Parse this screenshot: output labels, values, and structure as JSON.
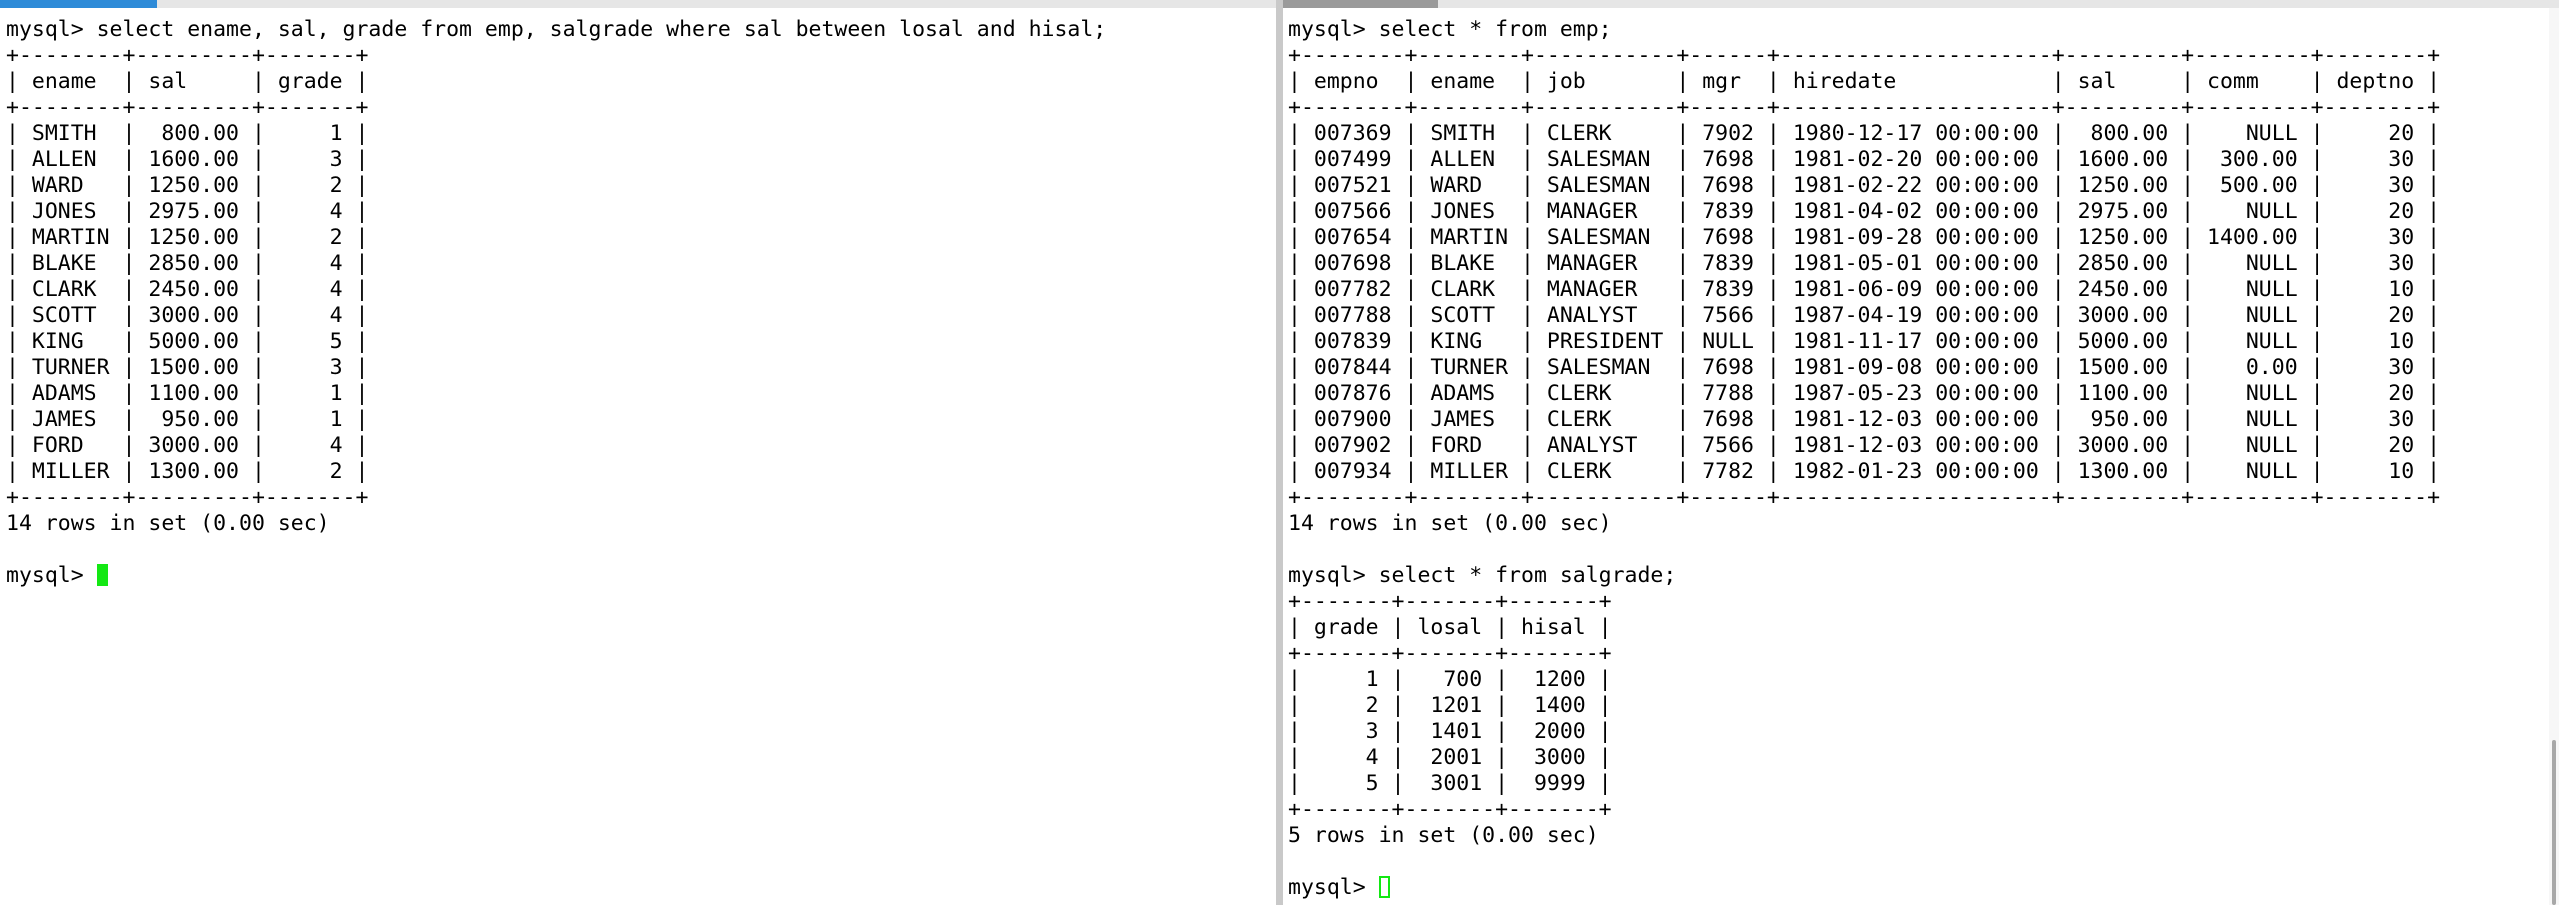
{
  "accent_color": "#2e8bd8",
  "cursor_color": "#13e813",
  "left_pane": {
    "lines": [
      "mysql> select ename, sal, grade from emp, salgrade where sal between losal and hisal;",
      "+--------+---------+-------+",
      "| ename  | sal     | grade |",
      "+--------+---------+-------+",
      "| SMITH  |  800.00 |     1 |",
      "| ALLEN  | 1600.00 |     3 |",
      "| WARD   | 1250.00 |     2 |",
      "| JONES  | 2975.00 |     4 |",
      "| MARTIN | 1250.00 |     2 |",
      "| BLAKE  | 2850.00 |     4 |",
      "| CLARK  | 2450.00 |     4 |",
      "| SCOTT  | 3000.00 |     4 |",
      "| KING   | 5000.00 |     5 |",
      "| TURNER | 1500.00 |     3 |",
      "| ADAMS  | 1100.00 |     1 |",
      "| JAMES  |  950.00 |     1 |",
      "| FORD   | 3000.00 |     4 |",
      "| MILLER | 1300.00 |     2 |",
      "+--------+---------+-------+",
      "14 rows in set (0.00 sec)",
      ""
    ],
    "prompt": "mysql> "
  },
  "right_pane": {
    "lines": [
      "mysql> select * from emp;",
      "+--------+--------+-----------+------+---------------------+---------+---------+--------+",
      "| empno  | ename  | job       | mgr  | hiredate            | sal     | comm    | deptno |",
      "+--------+--------+-----------+------+---------------------+---------+---------+--------+",
      "| 007369 | SMITH  | CLERK     | 7902 | 1980-12-17 00:00:00 |  800.00 |    NULL |     20 |",
      "| 007499 | ALLEN  | SALESMAN  | 7698 | 1981-02-20 00:00:00 | 1600.00 |  300.00 |     30 |",
      "| 007521 | WARD   | SALESMAN  | 7698 | 1981-02-22 00:00:00 | 1250.00 |  500.00 |     30 |",
      "| 007566 | JONES  | MANAGER   | 7839 | 1981-04-02 00:00:00 | 2975.00 |    NULL |     20 |",
      "| 007654 | MARTIN | SALESMAN  | 7698 | 1981-09-28 00:00:00 | 1250.00 | 1400.00 |     30 |",
      "| 007698 | BLAKE  | MANAGER   | 7839 | 1981-05-01 00:00:00 | 2850.00 |    NULL |     30 |",
      "| 007782 | CLARK  | MANAGER   | 7839 | 1981-06-09 00:00:00 | 2450.00 |    NULL |     10 |",
      "| 007788 | SCOTT  | ANALYST   | 7566 | 1987-04-19 00:00:00 | 3000.00 |    NULL |     20 |",
      "| 007839 | KING   | PRESIDENT | NULL | 1981-11-17 00:00:00 | 5000.00 |    NULL |     10 |",
      "| 007844 | TURNER | SALESMAN  | 7698 | 1981-09-08 00:00:00 | 1500.00 |    0.00 |     30 |",
      "| 007876 | ADAMS  | CLERK     | 7788 | 1987-05-23 00:00:00 | 1100.00 |    NULL |     20 |",
      "| 007900 | JAMES  | CLERK     | 7698 | 1981-12-03 00:00:00 |  950.00 |    NULL |     30 |",
      "| 007902 | FORD   | ANALYST   | 7566 | 1981-12-03 00:00:00 | 3000.00 |    NULL |     20 |",
      "| 007934 | MILLER | CLERK     | 7782 | 1982-01-23 00:00:00 | 1300.00 |    NULL |     10 |",
      "+--------+--------+-----------+------+---------------------+---------+---------+--------+",
      "14 rows in set (0.00 sec)",
      "",
      "mysql> select * from salgrade;",
      "+-------+-------+-------+",
      "| grade | losal | hisal |",
      "+-------+-------+-------+",
      "|     1 |   700 |  1200 |",
      "|     2 |  1201 |  1400 |",
      "|     3 |  1401 |  2000 |",
      "|     4 |  2001 |  3000 |",
      "|     5 |  3001 |  9999 |",
      "+-------+-------+-------+",
      "5 rows in set (0.00 sec)",
      ""
    ],
    "prompt": "mysql> "
  }
}
